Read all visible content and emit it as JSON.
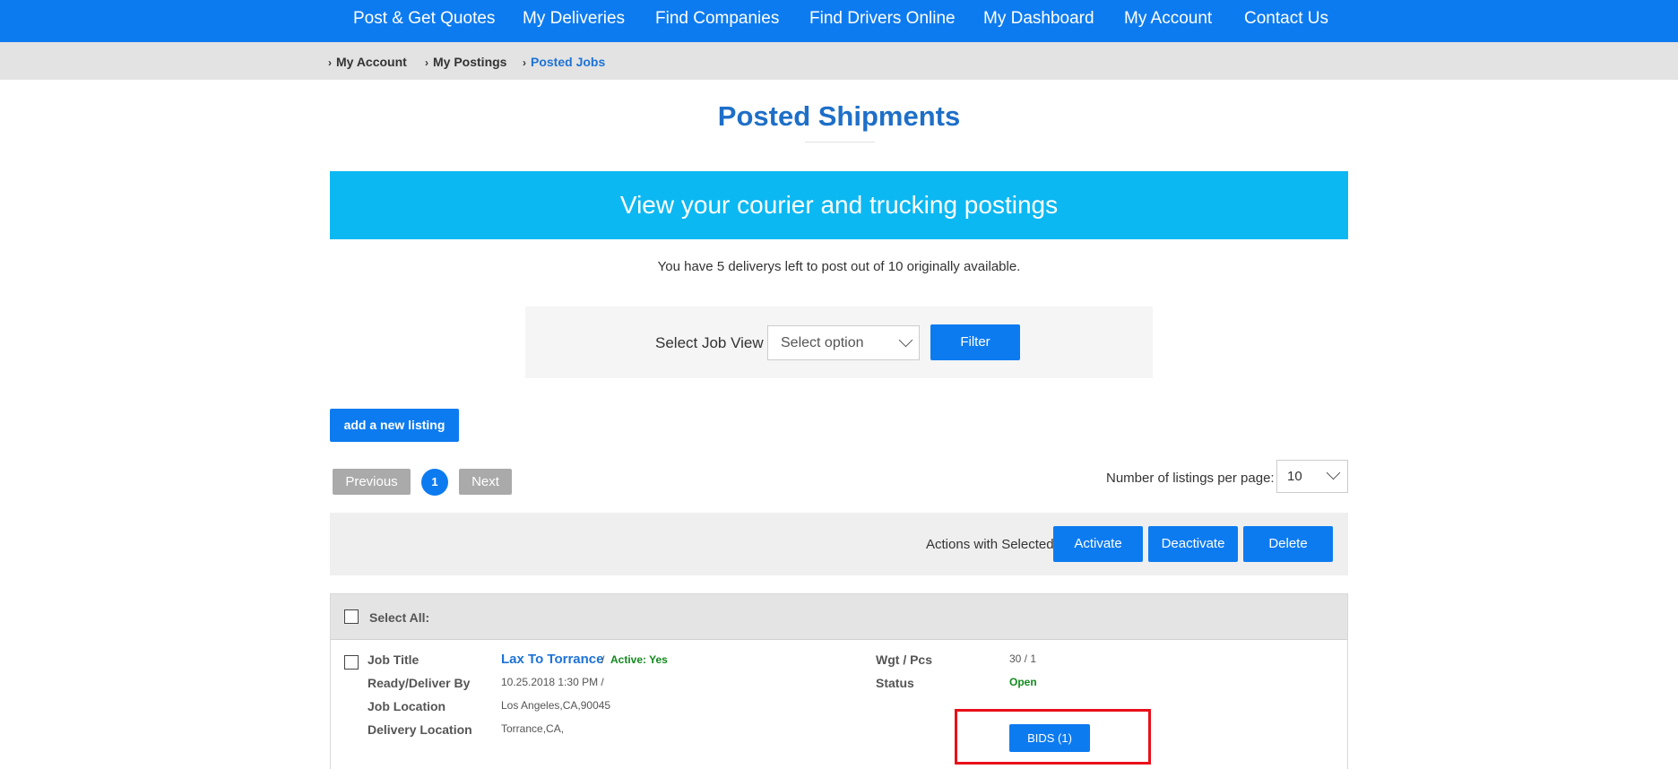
{
  "nav": {
    "items": [
      "Post & Get Quotes",
      "My Deliveries",
      "Find Companies",
      "Find Drivers Online",
      "My Dashboard",
      "My Account",
      "Contact Us"
    ]
  },
  "breadcrumb": {
    "items": [
      "My Account",
      "My Postings",
      "Posted Jobs"
    ]
  },
  "page": {
    "title": "Posted Shipments",
    "banner": "View your courier and trucking postings",
    "quota_text": "You have 5 deliverys left to post out of 10 originally available."
  },
  "filter": {
    "label": "Select Job View",
    "select_value": "Select option",
    "button": "Filter"
  },
  "add_listing": "add a new listing",
  "pagination": {
    "previous": "Previous",
    "current_page": "1",
    "next": "Next",
    "per_page_label": "Number of listings per page:",
    "per_page_value": "10"
  },
  "actions": {
    "label": "Actions with Selected:",
    "activate": "Activate",
    "deactivate": "Deactivate",
    "delete": "Delete"
  },
  "list": {
    "select_all": "Select All:",
    "job": {
      "labels": {
        "job_title": "Job Title",
        "ready_deliver": "Ready/Deliver By",
        "job_location": "Job Location",
        "delivery_location": "Delivery Location",
        "wgt_pcs": "Wgt / Pcs",
        "status": "Status"
      },
      "title": "Lax To Torrance",
      "separator": "/",
      "active": "Active: Yes",
      "ready_deliver": "10.25.2018 1:30 PM /",
      "job_location": "Los Angeles,CA,90045",
      "delivery_location": "Torrance,CA,",
      "wgt_pcs": "30 / 1",
      "status": "Open",
      "bids_button": "BIDS (1)"
    }
  },
  "colors": {
    "primary": "#0d7bf0",
    "banner": "#0cb8f2",
    "title": "#1e6fc8",
    "success": "#118a1d",
    "highlight": "#e8101a"
  }
}
